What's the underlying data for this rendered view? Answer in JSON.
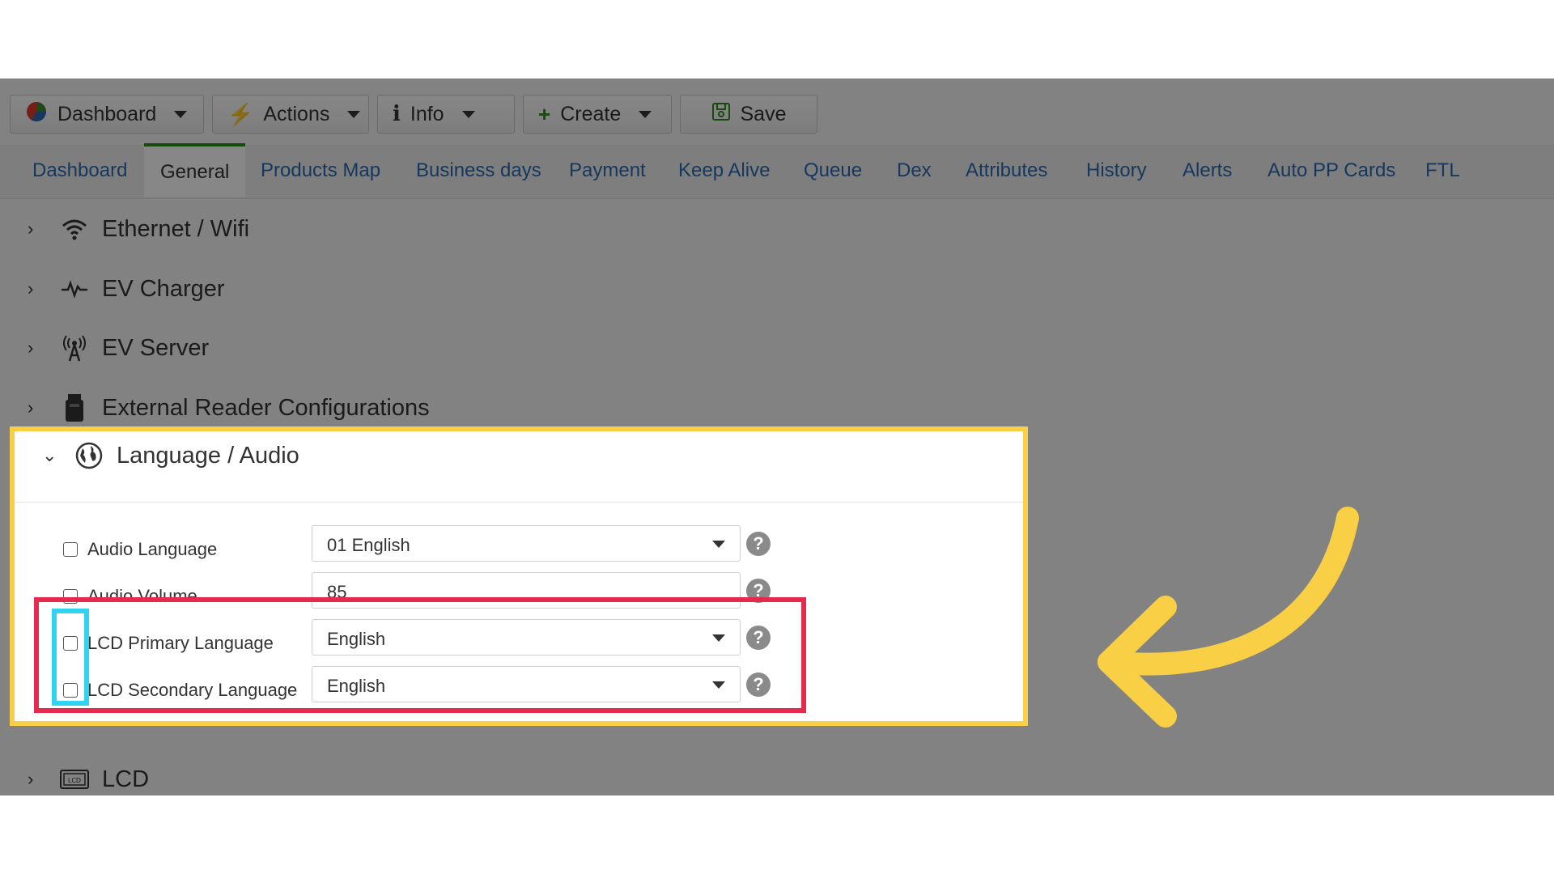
{
  "toolbar": {
    "dashboard": "Dashboard",
    "actions": "Actions",
    "info": "Info",
    "create": "Create",
    "save": "Save"
  },
  "tabs": [
    "Dashboard",
    "General",
    "Products Map",
    "Business days",
    "Payment",
    "Keep Alive",
    "Queue",
    "Dex",
    "Attributes",
    "History",
    "Alerts",
    "Auto PP Cards",
    "FTL"
  ],
  "active_tab": "General",
  "sections": {
    "ethernet": "Ethernet / Wifi",
    "ev_charger": "EV Charger",
    "ev_server": "EV Server",
    "external_reader": "External Reader Configurations",
    "language_audio": "Language / Audio",
    "lcd": "LCD"
  },
  "form": {
    "audio_language": {
      "label": "Audio Language",
      "value": "01 English"
    },
    "audio_volume": {
      "label": "Audio Volume",
      "value": "85"
    },
    "lcd_primary": {
      "label": "LCD Primary Language",
      "value": "English"
    },
    "lcd_secondary": {
      "label": "LCD Secondary Language",
      "value": "English"
    }
  },
  "help_glyph": "?",
  "colors": {
    "highlight_yellow": "#f9cf45",
    "highlight_red": "#e5294f",
    "highlight_cyan": "#2fd5f0",
    "tab_link": "#2a6bb0",
    "active_tab_border": "#2e8b1e"
  }
}
